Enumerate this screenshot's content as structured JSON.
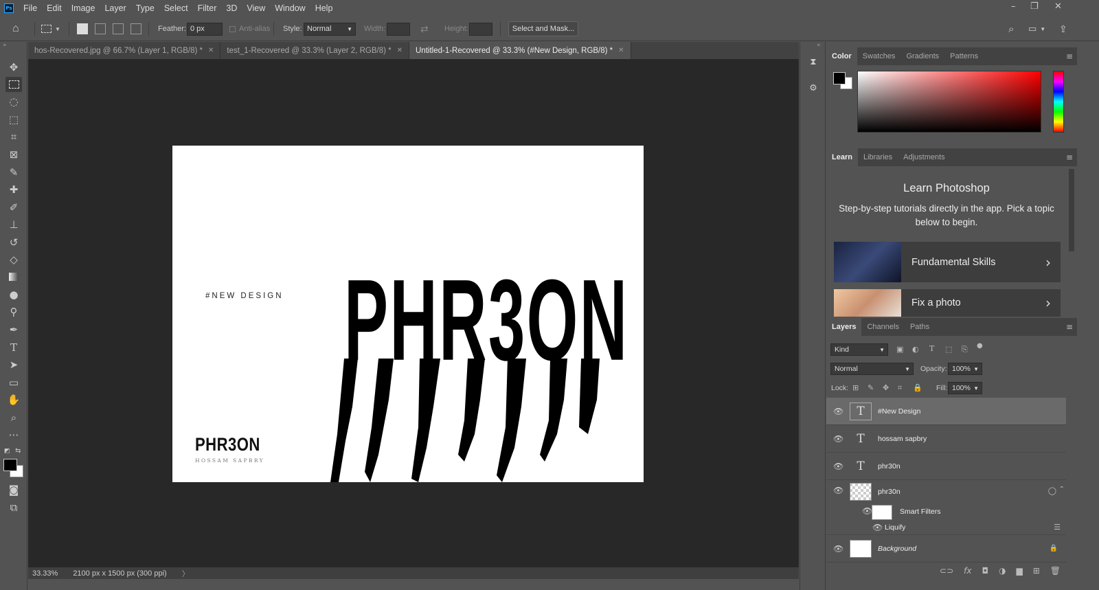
{
  "menu": {
    "logo": "Ps",
    "items": [
      "File",
      "Edit",
      "Image",
      "Layer",
      "Type",
      "Select",
      "Filter",
      "3D",
      "View",
      "Window",
      "Help"
    ]
  },
  "options": {
    "feather_label": "Feather:",
    "feather_value": "0 px",
    "antialias_label": "Anti-alias",
    "style_label": "Style:",
    "style_value": "Normal",
    "width_label": "Width:",
    "height_label": "Height:",
    "select_mask_label": "Select and Mask..."
  },
  "tabs": [
    {
      "label": "hos-Recovered.jpg @ 66.7% (Layer 1, RGB/8) *",
      "active": false
    },
    {
      "label": "test_1-Recovered @ 33.3% (Layer 2, RGB/8) *",
      "active": false
    },
    {
      "label": "Untitled-1-Recovered @ 33.3% (#New Design, RGB/8) *",
      "active": true
    }
  ],
  "canvas": {
    "new_design_text": "#NEW DESIGN",
    "small_logo": "PHR3ON",
    "small_sub": "HOSSAM SAPBRY",
    "big_text": "PHR3ON"
  },
  "status": {
    "zoom": "33.33%",
    "doc_info": "2100 px x 1500 px (300 ppi)"
  },
  "color_panel": {
    "tabs": [
      "Color",
      "Swatches",
      "Gradients",
      "Patterns"
    ],
    "foreground": "#000000",
    "background": "#ffffff"
  },
  "learn_panel": {
    "tabs": [
      "Learn",
      "Libraries",
      "Adjustments"
    ],
    "title": "Learn Photoshop",
    "subtitle": "Step-by-step tutorials directly in the app. Pick a topic below to begin.",
    "cards": [
      {
        "label": "Fundamental Skills"
      },
      {
        "label": "Fix a photo"
      }
    ]
  },
  "layers_panel": {
    "tabs": [
      "Layers",
      "Channels",
      "Paths"
    ],
    "kind_label": "Kind",
    "blend_mode": "Normal",
    "opacity_label": "Opacity:",
    "opacity_value": "100%",
    "lock_label": "Lock:",
    "fill_label": "Fill:",
    "fill_value": "100%",
    "layers": [
      {
        "name": "#New Design",
        "type": "text",
        "selected": true
      },
      {
        "name": "hossam sapbry",
        "type": "text",
        "selected": false
      },
      {
        "name": "phr30n",
        "type": "text",
        "selected": false
      },
      {
        "name": "phr30n",
        "type": "smart",
        "selected": false
      }
    ],
    "smart_filters_label": "Smart Filters",
    "liquify_label": "Liquify",
    "background_label": "Background"
  }
}
